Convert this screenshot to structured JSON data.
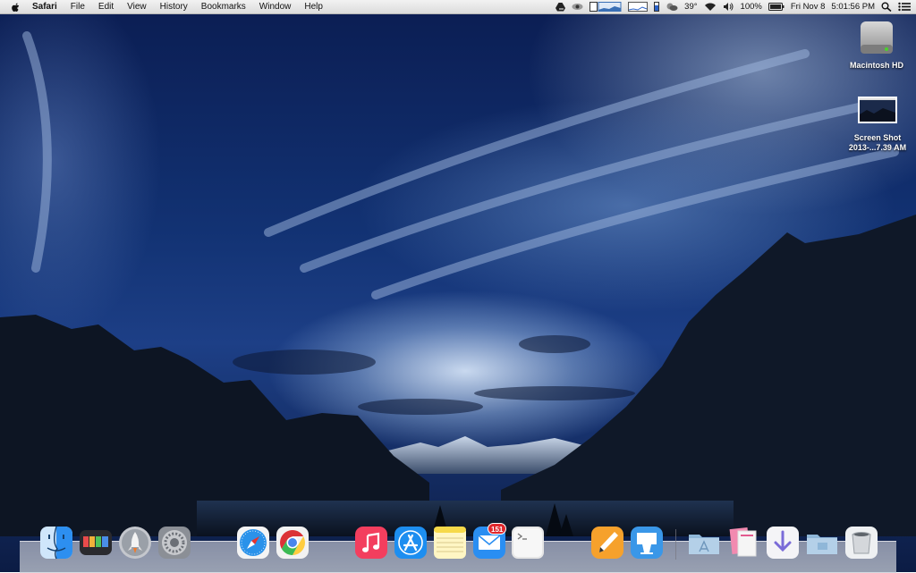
{
  "menubar": {
    "app_name": "Safari",
    "menus": [
      "File",
      "Edit",
      "View",
      "History",
      "Bookmarks",
      "Window",
      "Help"
    ],
    "status": {
      "temperature": "39°",
      "battery": "100%",
      "date": "Fri Nov 8",
      "time": "5:01:56 PM",
      "icons": [
        "google-drive-icon",
        "eye-icon",
        "cpu-graph-icon",
        "network-graph-icon",
        "memory-icon",
        "wifi-icon",
        "volume-icon",
        "battery-icon",
        "spotlight-icon",
        "notification-center-icon"
      ]
    }
  },
  "desktop_icons": {
    "hd": {
      "label": "Macintosh HD"
    },
    "screenshot": {
      "label_line1": "Screen Shot",
      "label_line2": "2013-...7.39 AM"
    }
  },
  "dock": {
    "items": [
      "Finder",
      "Mission Control",
      "Launchpad",
      "System Preferences",
      "Safari",
      "Google Chrome",
      "iTunes",
      "App Store",
      "Notes",
      "Mail",
      "Terminal",
      "Pages",
      "Keynote",
      "Applications",
      "Documents",
      "Downloads",
      "Folder",
      "Trash"
    ],
    "mail_badge": "151"
  },
  "colors": {
    "accent_badge": "#e0272c",
    "sky": "#123273"
  }
}
